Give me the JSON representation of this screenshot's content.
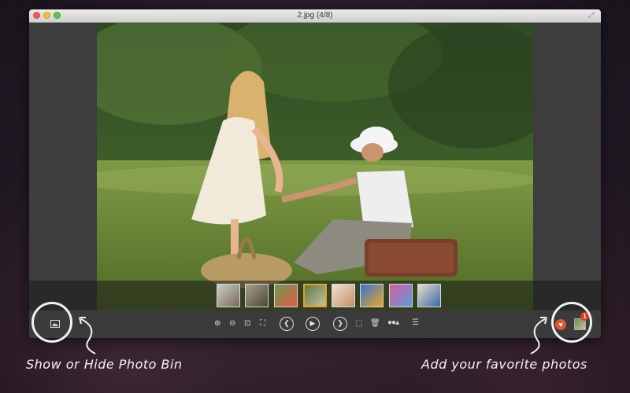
{
  "window": {
    "title": "2.jpg (4/8)"
  },
  "photo_bin": {
    "thumbnail_count": 8,
    "selected_index": 3
  },
  "toolbar": {
    "icons": [
      "zoom-in-icon",
      "zoom-out-icon",
      "fit-to-window-icon",
      "actual-size-icon",
      "previous-icon",
      "play-icon",
      "next-icon",
      "crop-icon",
      "trash-icon",
      "more-icon",
      "list-icon"
    ]
  },
  "favorites": {
    "badge_count": "1"
  },
  "captions": {
    "left": "Show or Hide Photo Bin",
    "right": "Add your favorite photos"
  },
  "colors": {
    "accent": "#e8a21b",
    "favorite": "#e1562f",
    "badge": "#d9381e"
  }
}
